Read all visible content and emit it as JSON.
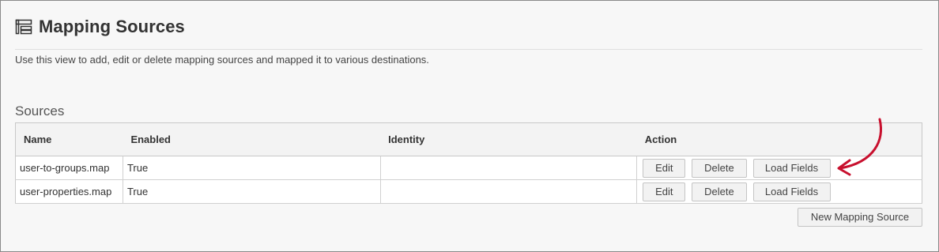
{
  "page": {
    "title": "Mapping Sources",
    "description": "Use this view to add, edit or delete mapping sources and mapped it to various destinations."
  },
  "sources": {
    "heading": "Sources",
    "columns": [
      "Name",
      "Enabled",
      "Identity",
      "Action"
    ],
    "rows": [
      {
        "name": "user-to-groups.map",
        "enabled": "True",
        "identity": ""
      },
      {
        "name": "user-properties.map",
        "enabled": "True",
        "identity": ""
      }
    ],
    "actions": {
      "edit": "Edit",
      "delete": "Delete",
      "load_fields": "Load Fields"
    },
    "new_button": "New Mapping Source"
  },
  "colors": {
    "annotation_arrow": "#c8102e"
  },
  "icons": {
    "title": "mapping-sources-icon"
  }
}
